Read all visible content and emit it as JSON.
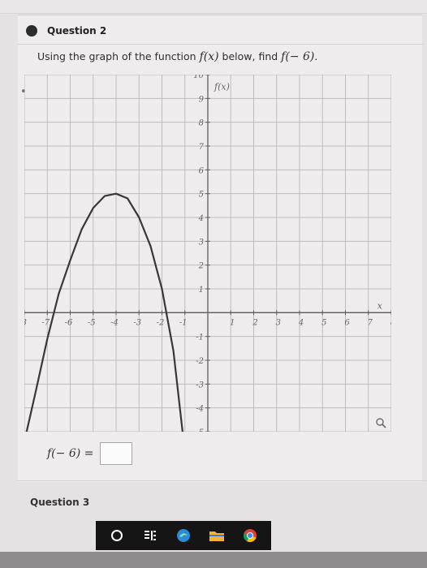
{
  "question": {
    "title": "Question 2",
    "prompt_prefix": "Using the graph of the function ",
    "prompt_func": "f(x)",
    "prompt_middle": " below, find ",
    "prompt_target": "f(− 6)",
    "prompt_suffix": "."
  },
  "answer": {
    "label": "f(− 6) =",
    "value": ""
  },
  "next_question": {
    "title": "Question 3"
  },
  "chart_data": {
    "type": "line",
    "ylabel": "f(x)",
    "xlabel": "x",
    "xlim": [
      -8,
      8
    ],
    "ylim": [
      -5,
      10
    ],
    "x_tick_labels": [
      "-8",
      "-7",
      "-6",
      "-5",
      "-4",
      "-3",
      "-2",
      "-1",
      "1",
      "2",
      "3",
      "4",
      "5",
      "6",
      "7",
      "8"
    ],
    "y_tick_labels": [
      "10",
      "9",
      "8",
      "7",
      "6",
      "5",
      "4",
      "3",
      "2",
      "1",
      "-1",
      "-2",
      "-3",
      "-4",
      "-5"
    ],
    "grid": true,
    "series": [
      {
        "x": [
          -7.9,
          -7.5,
          -7.0,
          -6.5,
          -6.0,
          -5.5,
          -5.0,
          -4.5,
          -4.0,
          -3.5,
          -3.0,
          -2.5,
          -2.0,
          -1.5,
          -1.1
        ],
        "y": [
          -5.0,
          -3.3,
          -1.1,
          0.8,
          2.2,
          3.5,
          4.4,
          4.9,
          5.0,
          4.8,
          4.0,
          2.8,
          1.0,
          -1.6,
          -5.0
        ]
      }
    ],
    "colors": {
      "grid": "#bdbcbc",
      "axis": "#5e5e5e",
      "curve": "#383838",
      "text": "#666666"
    }
  },
  "taskbar": {
    "icons": [
      "search-circle-icon",
      "task-view-icon",
      "edge-icon",
      "file-explorer-icon",
      "chrome-icon"
    ],
    "colors": {
      "edge": "#2a8bd8",
      "folder": "#f2b23a",
      "chrome_red": "#db4437",
      "chrome_yellow": "#f4c20d",
      "chrome_green": "#0f9d58",
      "chrome_blue": "#4285f4"
    }
  }
}
